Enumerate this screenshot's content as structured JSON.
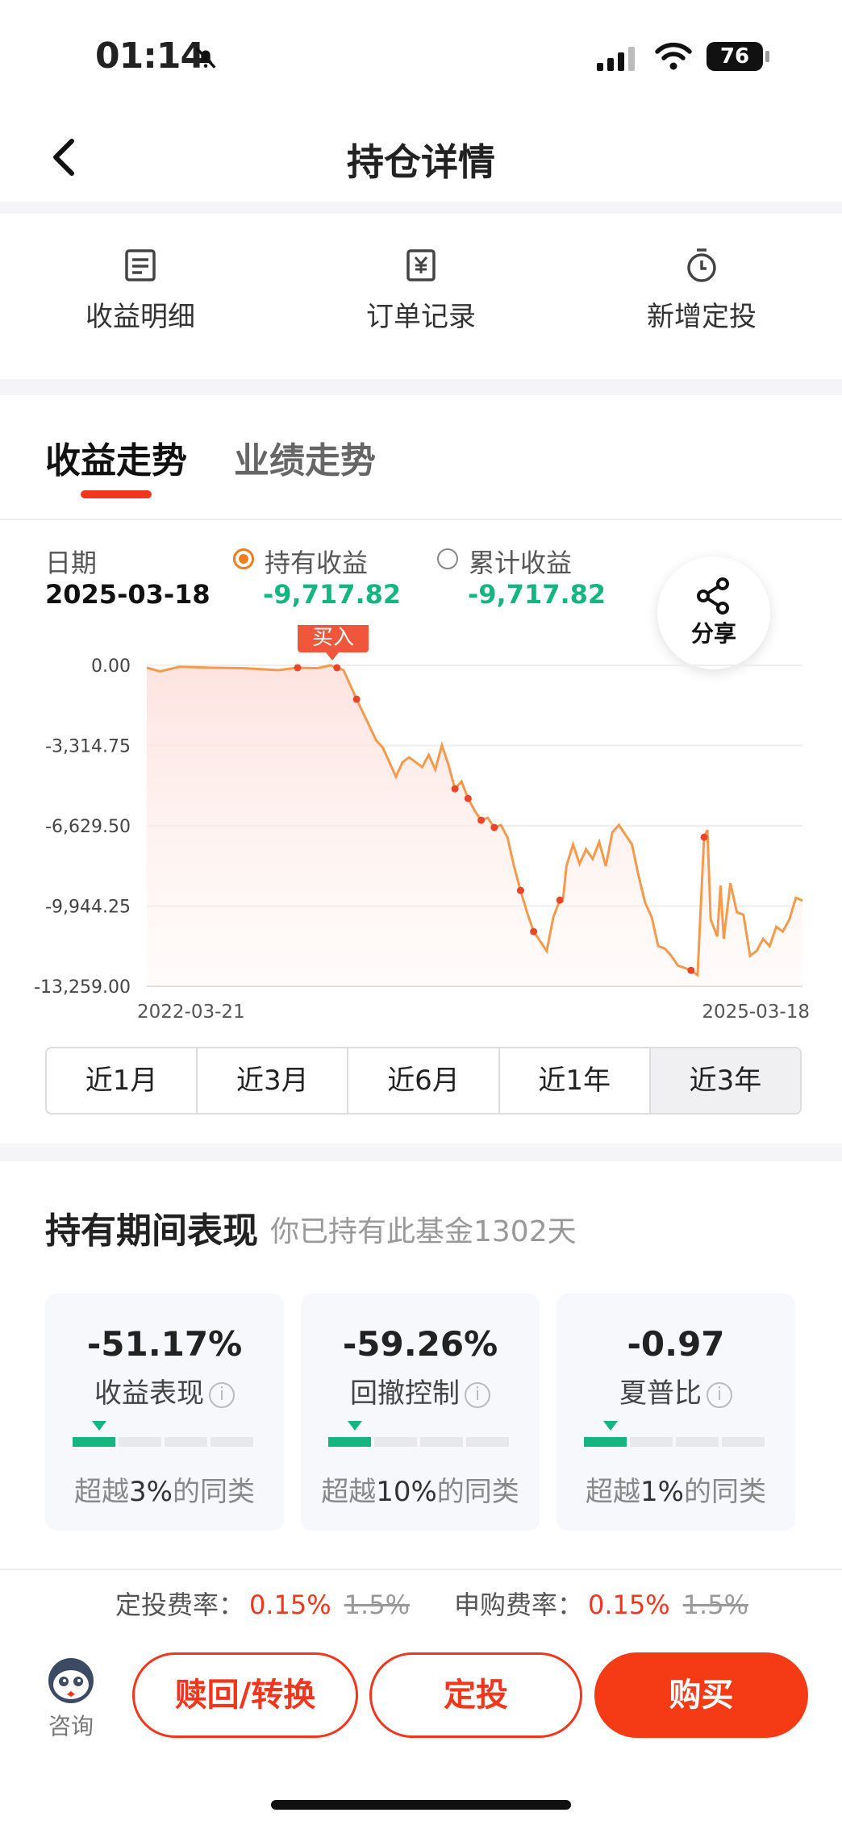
{
  "status_bar": {
    "time": "01:14",
    "battery": "76"
  },
  "nav": {
    "title": "持仓详情"
  },
  "quick_actions": [
    {
      "label": "收益明细",
      "icon": "document-list-icon"
    },
    {
      "label": "订单记录",
      "icon": "yuan-receipt-icon"
    },
    {
      "label": "新增定投",
      "icon": "stopwatch-icon"
    }
  ],
  "tabs": {
    "active": "收益走势",
    "inactive": "业绩走势"
  },
  "legend": {
    "date_label": "日期",
    "date_value": "2025-03-18",
    "holding_label": "持有收益",
    "holding_value": "-9,717.82",
    "cumulative_label": "累计收益",
    "cumulative_value": "-9,717.82"
  },
  "share": {
    "label": "分享",
    "icon": "share-icon"
  },
  "colors": {
    "accent": "#f0361c",
    "line": "#f39a4c",
    "green": "#15b57f"
  },
  "chart_data": {
    "type": "area",
    "y_ticks": [
      "0.00",
      "-3,314.75",
      "-6,629.50",
      "-9,944.25",
      "-13,259.00"
    ],
    "ylim": [
      -13259,
      0
    ],
    "x_tick_labels": [
      "2022-03-21",
      "2025-03-18"
    ],
    "buy_label": "买入",
    "grid": true,
    "series": [
      {
        "x": [
          0,
          0.02,
          0.05,
          0.1,
          0.15,
          0.2,
          0.23,
          0.26,
          0.28,
          0.3,
          0.32,
          0.35,
          0.36,
          0.38,
          0.39,
          0.4,
          0.41,
          0.42,
          0.43,
          0.44,
          0.45,
          0.46,
          0.47,
          0.48,
          0.49,
          0.5,
          0.51,
          0.52,
          0.53,
          0.54,
          0.55,
          0.56,
          0.57,
          0.58,
          0.59,
          0.6,
          0.61,
          0.62,
          0.63,
          0.635,
          0.64,
          0.65,
          0.66,
          0.67,
          0.68,
          0.69,
          0.7,
          0.71,
          0.72,
          0.73,
          0.74,
          0.75,
          0.76,
          0.77,
          0.78,
          0.79,
          0.8,
          0.81,
          0.82,
          0.83,
          0.84,
          0.85,
          0.855,
          0.86,
          0.87,
          0.875,
          0.88,
          0.89,
          0.9,
          0.91,
          0.92,
          0.93,
          0.94,
          0.95,
          0.96,
          0.97,
          0.98,
          0.99,
          1.0
        ],
        "y": [
          -100,
          -250,
          -60,
          -100,
          -120,
          -200,
          -100,
          -120,
          0,
          -200,
          -1400,
          -3100,
          -3400,
          -4600,
          -4000,
          -3800,
          -4000,
          -4200,
          -3700,
          -4300,
          -3300,
          -4100,
          -5100,
          -4800,
          -5500,
          -6000,
          -6400,
          -6300,
          -6700,
          -6600,
          -7100,
          -8300,
          -9300,
          -10200,
          -11000,
          -11400,
          -11800,
          -10400,
          -9700,
          -9600,
          -8300,
          -7400,
          -8200,
          -7600,
          -8000,
          -7300,
          -8300,
          -6900,
          -6600,
          -7000,
          -7400,
          -8700,
          -9800,
          -10400,
          -11600,
          -11700,
          -12000,
          -12400,
          -12500,
          -12600,
          -12800,
          -7100,
          -6800,
          -10500,
          -11200,
          -9100,
          -11300,
          -9000,
          -10200,
          -10300,
          -12000,
          -11800,
          -11300,
          -11600,
          -10800,
          -11000,
          -10500,
          -9600,
          -9717.82
        ]
      }
    ]
  },
  "ranges": [
    "近1月",
    "近3月",
    "近6月",
    "近1年",
    "近3年"
  ],
  "active_range": "近3年",
  "performance": {
    "title": "持有期间表现",
    "subtitle": "你已持有此基金1302天",
    "cards": [
      {
        "value": "-51.17%",
        "name": "收益表现",
        "prefix": "超越",
        "pct": "3%",
        "suffix": "的同类",
        "rank": 0.03
      },
      {
        "value": "-59.26%",
        "name": "回撤控制",
        "prefix": "超越",
        "pct": "10%",
        "suffix": "的同类",
        "rank": 0.1
      },
      {
        "value": "-0.97",
        "name": "夏普比",
        "prefix": "超越",
        "pct": "1%",
        "suffix": "的同类",
        "rank": 0.01
      }
    ]
  },
  "fees": {
    "dingtou_label": "定投费率：",
    "dingtou_rate": "0.15%",
    "dingtou_original": "1.5%",
    "purchase_label": "申购费率：",
    "purchase_rate": "0.15%",
    "purchase_original": "1.5%"
  },
  "actions": {
    "consult": "咨询",
    "redeem": "赎回/转换",
    "dingtou": "定投",
    "buy": "购买"
  }
}
